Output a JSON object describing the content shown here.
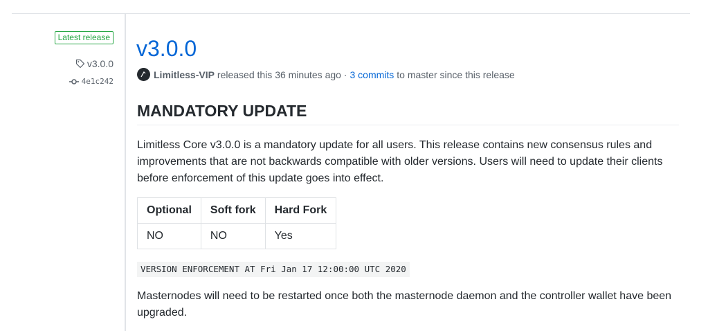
{
  "sidebar": {
    "badge": "Latest release",
    "tag": "v3.0.0",
    "commit": "4e1c242"
  },
  "release": {
    "title": "v3.0.0",
    "author": "Limitless-VIP",
    "released_text": "released this 36 minutes ago ·",
    "commits_link": "3 commits",
    "commits_suffix": "to master since this release"
  },
  "body": {
    "heading": "MANDATORY UPDATE",
    "paragraph1": "Limitless Core v3.0.0 is a mandatory update for all users. This release contains new consensus rules and improvements that are not backwards compatible with older versions. Users will need to update their clients before enforcement of this update goes into effect.",
    "table": {
      "headers": [
        "Optional",
        "Soft fork",
        "Hard Fork"
      ],
      "rows": [
        [
          "NO",
          "NO",
          "Yes"
        ]
      ]
    },
    "code": "VERSION ENFORCEMENT AT Fri Jan 17 12:00:00 UTC 2020",
    "paragraph2": "Masternodes will need to be restarted once both the masternode daemon and the controller wallet have been upgraded."
  },
  "colors": {
    "link": "#0366d6",
    "badge_green": "#28a745",
    "muted": "#586069"
  },
  "icons": {
    "tag": "tag-icon",
    "commit": "git-commit-icon"
  }
}
